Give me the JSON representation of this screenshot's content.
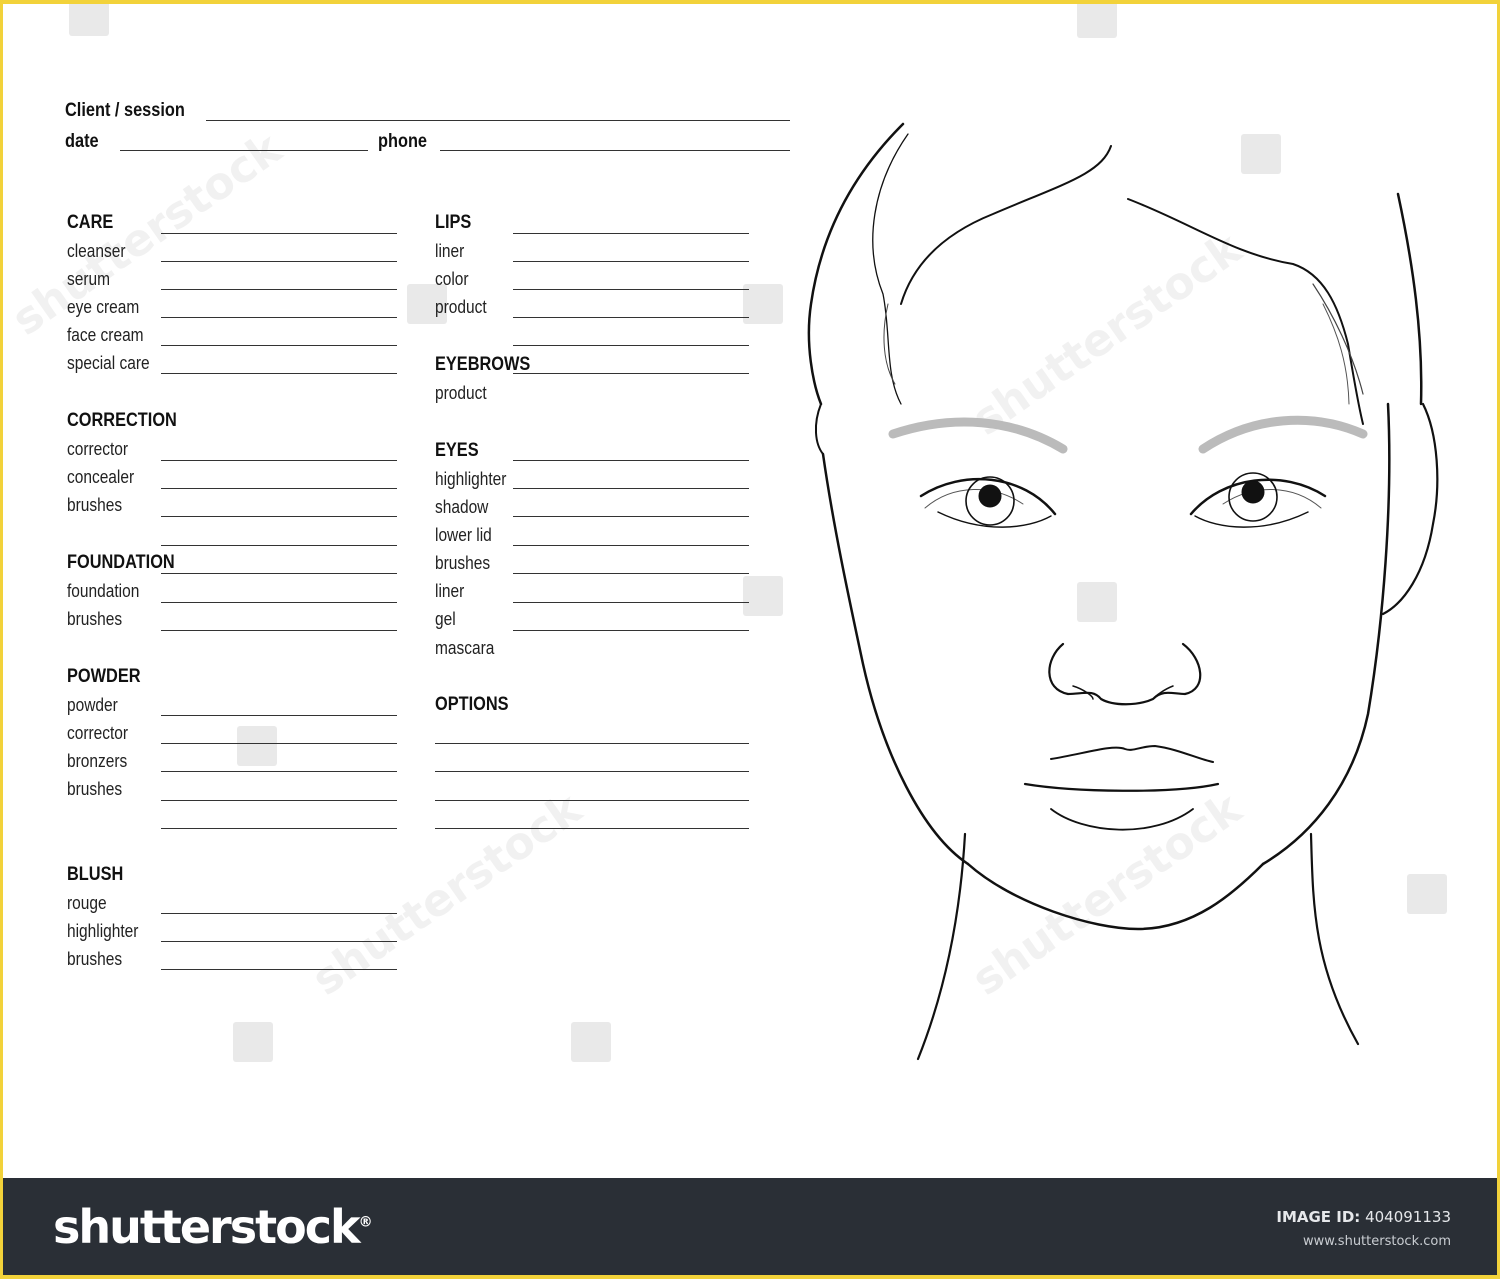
{
  "header": {
    "client_label": "Client / session",
    "date_label": "date",
    "phone_label": "phone"
  },
  "left_column": [
    {
      "title": "CARE",
      "items": [
        "cleanser",
        "serum",
        "eye cream",
        "face cream",
        "special care"
      ]
    },
    {
      "title": "CORRECTION",
      "items": [
        "corrector",
        "concealer",
        "brushes"
      ]
    },
    {
      "title": "FOUNDATION",
      "items": [
        "foundation",
        "brushes"
      ]
    },
    {
      "title": "POWDER",
      "items": [
        "powder",
        "corrector",
        "bronzers",
        "brushes"
      ]
    },
    {
      "title": "BLUSH",
      "items": [
        "rouge",
        "highlighter",
        "brushes"
      ]
    }
  ],
  "right_column": [
    {
      "title": "LIPS",
      "items": [
        "liner",
        "color",
        "product"
      ]
    },
    {
      "title": "EYEBROWS",
      "items": [
        "product"
      ]
    },
    {
      "title": "EYES",
      "items": [
        "highlighter",
        "shadow",
        "lower lid",
        "brushes",
        "liner",
        "gel",
        "mascara"
      ]
    },
    {
      "title": "OPTIONS",
      "items": []
    }
  ],
  "footer": {
    "brand": "shutterstock",
    "brand_mark": "®",
    "image_id_label": "IMAGE ID:",
    "image_id": "404091133",
    "website": "www.shutterstock.com"
  },
  "colors": {
    "frame": "#f2d23a",
    "footer_bg": "#2a2f36",
    "ink": "#222222"
  }
}
